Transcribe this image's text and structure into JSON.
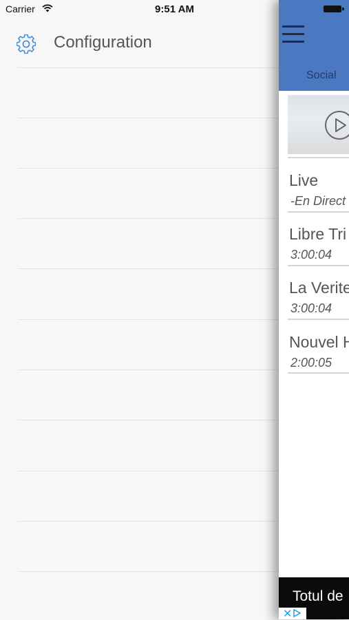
{
  "status_bar": {
    "carrier": "Carrier",
    "time": "9:51 AM"
  },
  "side_menu": {
    "title": "Configuration",
    "icon": "gear-icon",
    "accent_color": "#3d8ce0",
    "rows": 11
  },
  "main_panel": {
    "nav_color": "#4a79c1",
    "tab_label": "Social",
    "items": [
      {
        "title": "Live",
        "subtitle": "-En Direct"
      },
      {
        "title": "Libre Tri",
        "subtitle": "3:00:04"
      },
      {
        "title": "La Verite",
        "subtitle": "3:00:04"
      },
      {
        "title": "Nouvel H",
        "subtitle": "2:00:05"
      }
    ],
    "ad": {
      "text": "Totul de",
      "close_glyph": "✕"
    }
  }
}
